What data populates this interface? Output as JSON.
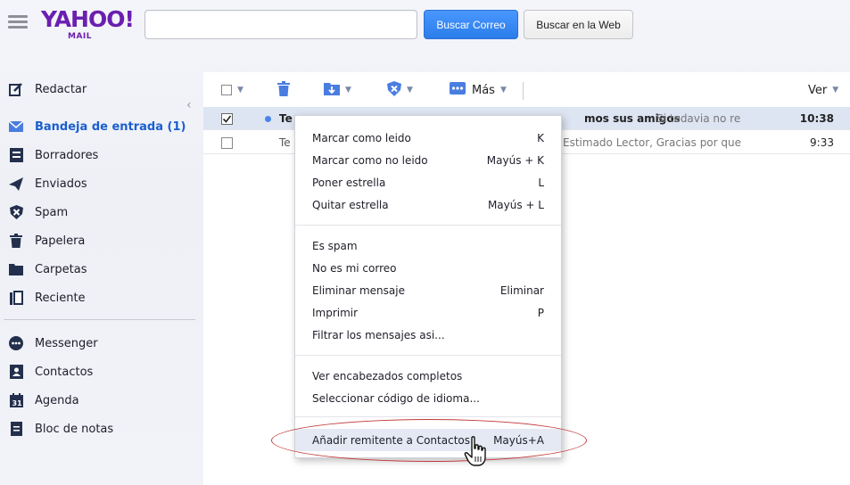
{
  "header": {
    "logo_word": "YAHOO!",
    "logo_sub": "MAIL",
    "search_value": "",
    "search_placeholder": "",
    "btn_search_mail": "Buscar Correo",
    "btn_search_web": "Buscar en la Web"
  },
  "sidebar": {
    "items": [
      {
        "label": "Redactar",
        "icon": "compose-icon"
      },
      {
        "label": "Bandeja de entrada (1)",
        "icon": "inbox-icon",
        "active": true
      },
      {
        "label": "Borradores",
        "icon": "drafts-icon"
      },
      {
        "label": "Enviados",
        "icon": "sent-icon"
      },
      {
        "label": "Spam",
        "icon": "spam-shield-icon"
      },
      {
        "label": "Papelera",
        "icon": "trash-icon"
      },
      {
        "label": "Carpetas",
        "icon": "folder-icon"
      },
      {
        "label": "Reciente",
        "icon": "recent-icon"
      },
      {
        "label": "Messenger",
        "icon": "messenger-icon"
      },
      {
        "label": "Contactos",
        "icon": "contacts-icon"
      },
      {
        "label": "Agenda",
        "icon": "calendar-icon"
      },
      {
        "label": "Bloc de notas",
        "icon": "notepad-icon"
      }
    ]
  },
  "toolbar": {
    "more_label": "Más",
    "view_label": "Ver"
  },
  "messages": [
    {
      "sender": "Te",
      "subject": "mos sus amigos",
      "preview": "Si todavia no re",
      "time": "10:38",
      "selected": true,
      "unread": true
    },
    {
      "sender": "Te",
      "subject": "",
      "preview": "Estimado Lector, Gracias por quer",
      "time": "9:33",
      "selected": false,
      "unread": false
    }
  ],
  "context_menu": {
    "groups": [
      [
        {
          "label": "Marcar como leido",
          "key": "K"
        },
        {
          "label": "Marcar como no leido",
          "key": "Mayús + K"
        },
        {
          "label": "Poner estrella",
          "key": "L"
        },
        {
          "label": "Quitar estrella",
          "key": "Mayús + L"
        }
      ],
      [
        {
          "label": "Es spam",
          "key": ""
        },
        {
          "label": "No es mi correo",
          "key": ""
        },
        {
          "label": "Eliminar mensaje",
          "key": "Eliminar"
        },
        {
          "label": "Imprimir",
          "key": "P"
        },
        {
          "label": "Filtrar los mensajes asi...",
          "key": ""
        }
      ],
      [
        {
          "label": "Ver encabezados completos",
          "key": ""
        },
        {
          "label": "Seleccionar código de idioma...",
          "key": ""
        }
      ],
      [
        {
          "label": "Añadir remitente a Contactos",
          "key": "Mayús+A",
          "highlighted": true
        }
      ]
    ]
  },
  "colors": {
    "brand_purple": "#6a1fb0",
    "accent_blue": "#2b7de9",
    "annotation_red": "#c23a3a"
  }
}
